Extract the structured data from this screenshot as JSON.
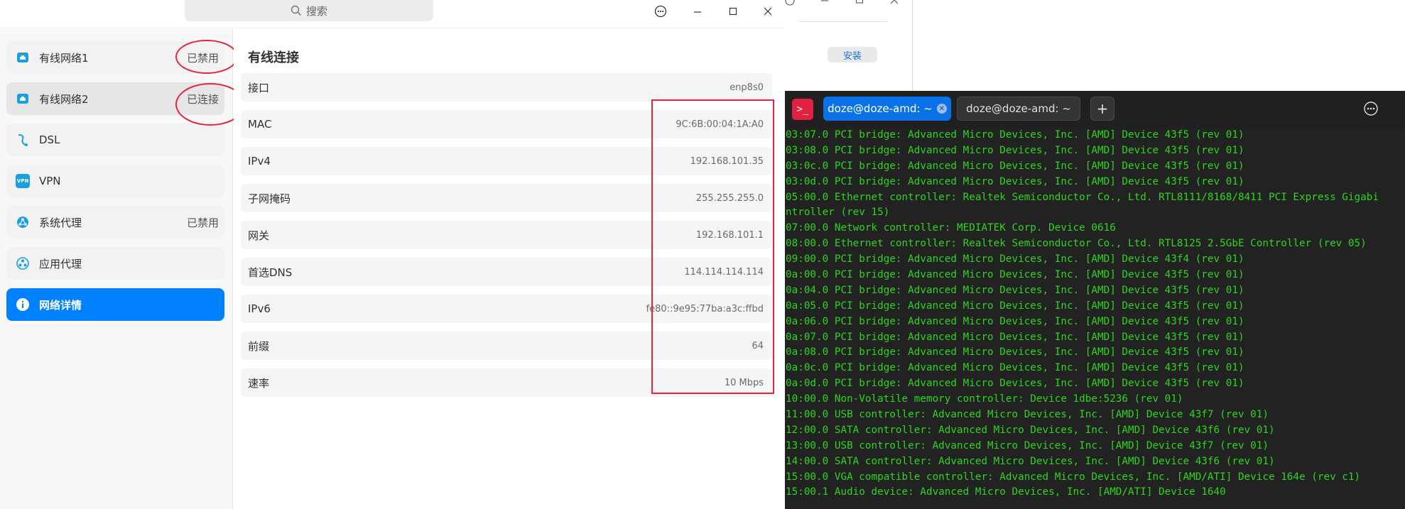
{
  "settings": {
    "search_placeholder": "搜索",
    "sidebar": [
      {
        "label": "有线网络1",
        "status": "已禁用",
        "icon": "wired-network-icon"
      },
      {
        "label": "有线网络2",
        "status": "已连接",
        "icon": "wired-network-icon"
      },
      {
        "label": "DSL",
        "status": "",
        "icon": "dsl-icon"
      },
      {
        "label": "VPN",
        "status": "",
        "icon": "vpn-icon",
        "icon_text": "VPN"
      },
      {
        "label": "系统代理",
        "status": "已禁用",
        "icon": "system-proxy-icon"
      },
      {
        "label": "应用代理",
        "status": "",
        "icon": "app-proxy-icon"
      },
      {
        "label": "网络详情",
        "status": "",
        "icon": "info-icon",
        "selected": true
      }
    ],
    "detail_title": "有线连接",
    "details": [
      {
        "key": "接口",
        "value": "enp8s0"
      },
      {
        "key": "MAC",
        "value": "9C:6B:00:04:1A:A0"
      },
      {
        "key": "IPv4",
        "value": "192.168.101.35"
      },
      {
        "key": "子网掩码",
        "value": "255.255.255.0"
      },
      {
        "key": "网关",
        "value": "192.168.101.1"
      },
      {
        "key": "首选DNS",
        "value": "114.114.114.114"
      },
      {
        "key": "IPv6",
        "value": "fe80::9e95:77ba:a3c:ffbd"
      },
      {
        "key": "前缀",
        "value": "64"
      },
      {
        "key": "速率",
        "value": "10 Mbps"
      }
    ]
  },
  "background_window": {
    "install_label": "安装"
  },
  "terminal": {
    "tabs": [
      "doze@doze-amd: ~",
      "doze@doze-amd: ~"
    ],
    "logo_text": ">_",
    "lines": [
      "03:07.0 PCI bridge: Advanced Micro Devices, Inc. [AMD] Device 43f5 (rev 01)",
      "03:08.0 PCI bridge: Advanced Micro Devices, Inc. [AMD] Device 43f5 (rev 01)",
      "03:0c.0 PCI bridge: Advanced Micro Devices, Inc. [AMD] Device 43f5 (rev 01)",
      "03:0d.0 PCI bridge: Advanced Micro Devices, Inc. [AMD] Device 43f5 (rev 01)",
      "05:00.0 Ethernet controller: Realtek Semiconductor Co., Ltd. RTL8111/8168/8411 PCI Express Gigabi",
      "ntroller (rev 15)",
      "07:00.0 Network controller: MEDIATEK Corp. Device 0616",
      "08:00.0 Ethernet controller: Realtek Semiconductor Co., Ltd. RTL8125 2.5GbE Controller (rev 05)",
      "09:00.0 PCI bridge: Advanced Micro Devices, Inc. [AMD] Device 43f4 (rev 01)",
      "0a:00.0 PCI bridge: Advanced Micro Devices, Inc. [AMD] Device 43f5 (rev 01)",
      "0a:04.0 PCI bridge: Advanced Micro Devices, Inc. [AMD] Device 43f5 (rev 01)",
      "0a:05.0 PCI bridge: Advanced Micro Devices, Inc. [AMD] Device 43f5 (rev 01)",
      "0a:06.0 PCI bridge: Advanced Micro Devices, Inc. [AMD] Device 43f5 (rev 01)",
      "0a:07.0 PCI bridge: Advanced Micro Devices, Inc. [AMD] Device 43f5 (rev 01)",
      "0a:08.0 PCI bridge: Advanced Micro Devices, Inc. [AMD] Device 43f5 (rev 01)",
      "0a:0c.0 PCI bridge: Advanced Micro Devices, Inc. [AMD] Device 43f5 (rev 01)",
      "0a:0d.0 PCI bridge: Advanced Micro Devices, Inc. [AMD] Device 43f5 (rev 01)",
      "10:00.0 Non-Volatile memory controller: Device 1dbe:5236 (rev 01)",
      "11:00.0 USB controller: Advanced Micro Devices, Inc. [AMD] Device 43f7 (rev 01)",
      "12:00.0 SATA controller: Advanced Micro Devices, Inc. [AMD] Device 43f6 (rev 01)",
      "13:00.0 USB controller: Advanced Micro Devices, Inc. [AMD] Device 43f7 (rev 01)",
      "14:00.0 SATA controller: Advanced Micro Devices, Inc. [AMD] Device 43f6 (rev 01)",
      "15:00.0 VGA compatible controller: Advanced Micro Devices, Inc. [AMD/ATI] Device 164e (rev c1)",
      "15:00.1 Audio device: Advanced Micro Devices, Inc. [AMD/ATI] Device 1640"
    ]
  },
  "colors": {
    "accent": "#0081ff",
    "annotation_red": "#e8233e",
    "terminal_bg": "#222222",
    "terminal_text": "#2fd41f",
    "terminal_tab_active": "#0a72e6"
  }
}
